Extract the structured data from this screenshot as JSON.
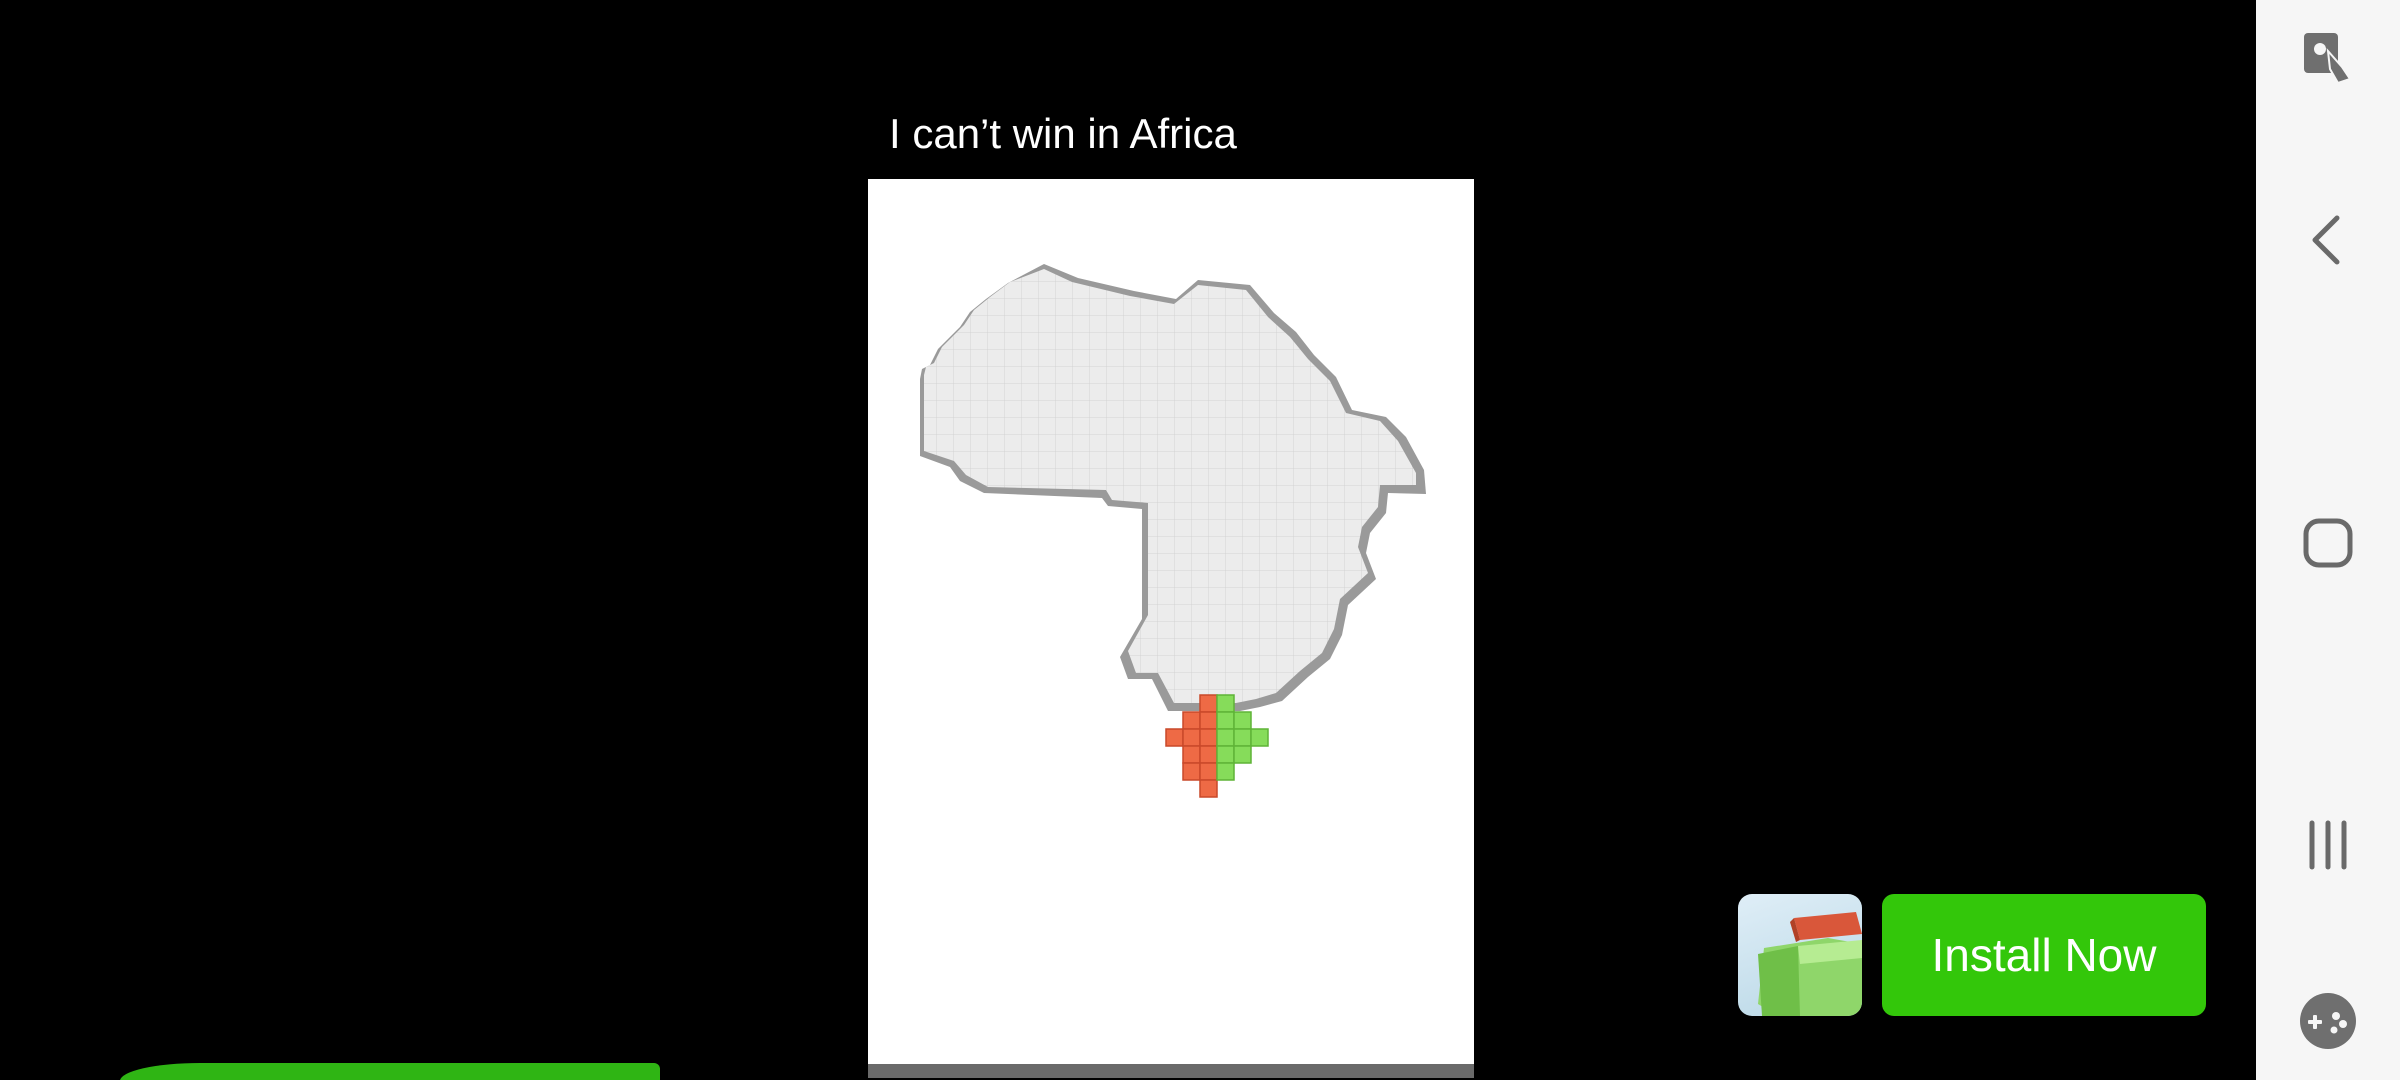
{
  "ad": {
    "caption": "I can’t win in Africa",
    "install_label": "Install Now",
    "app_icon": "block-puzzle-app-icon",
    "install_color": "#33c70a",
    "video_progress": 0.0,
    "timer_bar_color": "#2fb514"
  },
  "game": {
    "board": "africa-shaped-block-grid",
    "red_team_color": "#ee6a45",
    "green_team_color": "#86dc5a",
    "empty_cell_color": "#e9e9e9"
  },
  "navigation": {
    "buttons": [
      {
        "name": "assistant-touch-icon"
      },
      {
        "name": "back-icon"
      },
      {
        "name": "home-icon"
      },
      {
        "name": "recent-apps-icon"
      },
      {
        "name": "game-tools-icon"
      }
    ]
  }
}
